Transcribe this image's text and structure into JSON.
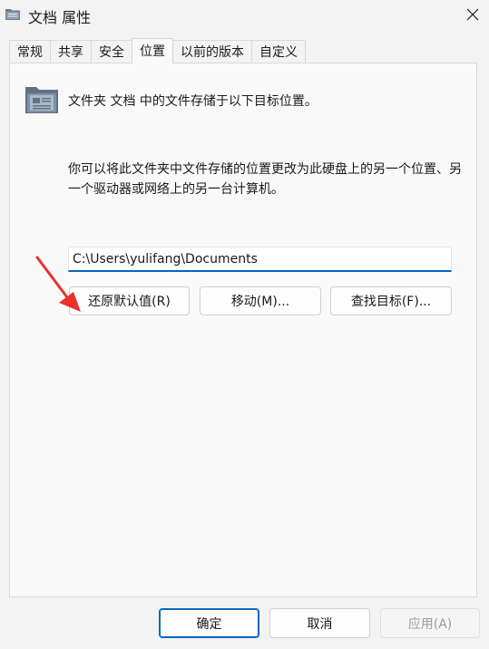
{
  "window": {
    "title": "文档 属性",
    "icon": "folder-icon",
    "close_icon": "close-icon"
  },
  "tabs": [
    {
      "label": "常规",
      "active": false
    },
    {
      "label": "共享",
      "active": false
    },
    {
      "label": "安全",
      "active": false
    },
    {
      "label": "位置",
      "active": true
    },
    {
      "label": "以前的版本",
      "active": false
    },
    {
      "label": "自定义",
      "active": false
    }
  ],
  "location": {
    "description": "文件夹 文档 中的文件存储于以下目标位置。",
    "help_text": "你可以将此文件夹中文件存储的位置更改为此硬盘上的另一个位置、另一个驱动器或网络上的另一台计算机。",
    "path_value": "C:\\Users\\yulifang\\Documents",
    "restore_button": "还原默认值(R)",
    "move_button": "移动(M)...",
    "find_target_button": "查找目标(F)..."
  },
  "footer": {
    "ok": "确定",
    "cancel": "取消",
    "apply": "应用(A)"
  },
  "colors": {
    "accent": "#0067c0",
    "annotation_arrow": "#e8322b"
  }
}
